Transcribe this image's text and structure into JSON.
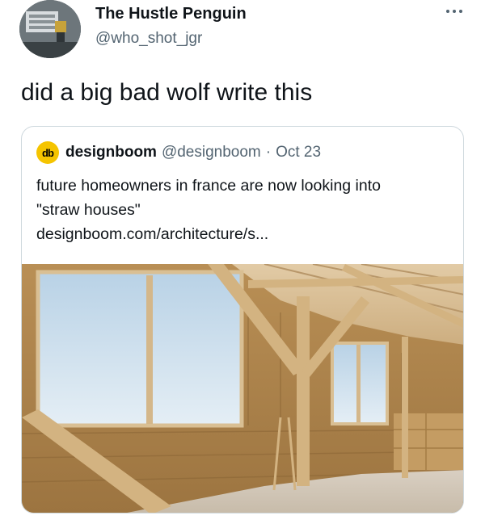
{
  "tweet": {
    "author": {
      "display_name": "The Hustle Penguin",
      "handle": "@who_shot_jgr"
    },
    "text": "did a big bad wolf write this",
    "more_icon": "more-horizontal-icon"
  },
  "quote": {
    "author": {
      "icon": "designboom-logo-icon",
      "icon_text": "db",
      "display_name": "designboom",
      "handle": "@designboom",
      "separator": "·",
      "date": "Oct 23"
    },
    "text_lines": [
      "future homeowners in france are now looking into",
      "\"straw houses\"",
      "designboom.com/architecture/s..."
    ]
  },
  "colors": {
    "text_primary": "#0f1419",
    "text_secondary": "#536471",
    "border": "#cfd9de",
    "designboom_yellow": "#f5c400"
  }
}
